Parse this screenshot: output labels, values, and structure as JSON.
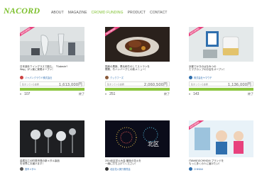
{
  "header": {
    "logo": "NACORD",
    "nav": [
      "ABOUT",
      "MAGAZINE",
      "CROWD FUNDING",
      "PRODUCT",
      "CONTACT"
    ]
  },
  "badge_text": "SUCCESS!",
  "cards": [
    {
      "desc": "日本酒をワイングラスで飲む。「Sakeute?\nWay」がっ楽に実現オープン！",
      "owner": "ジャパンクラウド株式会社",
      "amount_label": "集まっている金額",
      "amount": "1,613,000円",
      "supporters": "107",
      "days": "終了"
    },
    {
      "desc": "国産の黒豚、黒毛和牛のしてストランを\n開業。牛ハンバーグとの新メニュー！",
      "owner": "クックフーズ",
      "amount_label": "集まっている金額",
      "amount": "2,060,500円",
      "supporters": "251",
      "days": "終了"
    },
    {
      "desc": "京都でかきのはなみつの\nたマグカップのお店をオープン！",
      "owner": "株式会社ヤマウチ",
      "amount_label": "集まっている金額",
      "amount": "1,136,000円",
      "supporters": "143",
      "days": "終了"
    },
    {
      "desc": "金属加工の町燕市発の新メタル製品\nを世界にお届けます！",
      "owner": "燕市メタル"
    },
    {
      "desc": "2014北区花火大会 最後の花火を\n一緒に打ち上げてください！",
      "owner": "北区花火実行委員会"
    },
    {
      "desc": "ITAMAEのCHINDAI ブランドを\nもっと多くの人に届けたい！",
      "owner": "CHINDAI"
    }
  ]
}
